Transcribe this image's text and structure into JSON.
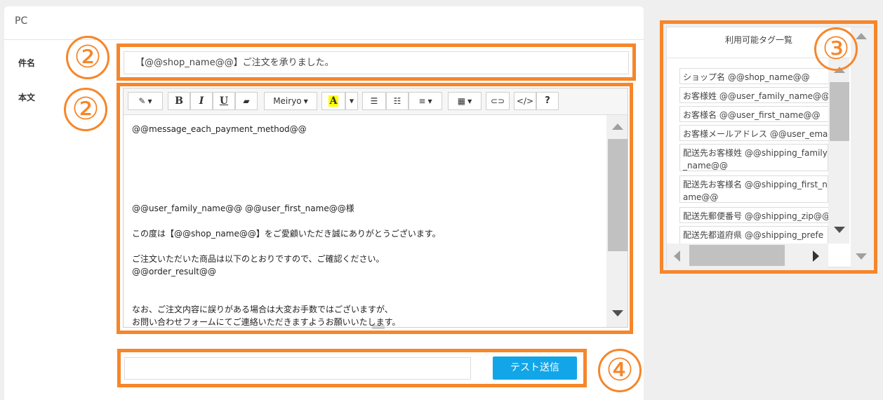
{
  "panel": {
    "title": "PC"
  },
  "subject": {
    "label": "件名",
    "value": "【@@shop_name@@】ご注文を承りました。"
  },
  "body": {
    "label": "本文",
    "lines": [
      "@@message_each_payment_method@@",
      "",
      "",
      "",
      "",
      "",
      "@@user_family_name@@ @@user_first_name@@様",
      "",
      "この度は【@@shop_name@@】をご愛顧いただき誠にありがとうございます。",
      "",
      "ご注文いただいた商品は以下のとおりですので、ご確認ください。",
      "@@order_result@@",
      "",
      "",
      "なお、ご注文内容に誤りがある場合は大変お手数ではございますが、",
      "お問い合わせフォームにてご連絡いただきますようお願いいたします。"
    ]
  },
  "toolbar": {
    "magic_label": "✎",
    "bold_label": "B",
    "italic_label": "I",
    "underline_label": "U",
    "eraser_label": "▰",
    "font_label": "Meiryo",
    "color_label": "A",
    "ul_label": "☰",
    "ol_label": "☷",
    "align_label": "≡",
    "table_label": "▦",
    "link_label": "⊂⊃",
    "code_label": "</>",
    "help_label": "?",
    "caret": "▼"
  },
  "callouts": [
    "②",
    "②",
    "③",
    "④"
  ],
  "test": {
    "button_label": "テスト送信",
    "value": ""
  },
  "tags": {
    "title": "利用可能タグ一覧",
    "items": [
      "ショップ名 @@shop_name@@",
      "お客様姓 @@user_family_name@@",
      "お客様名 @@user_first_name@@",
      "お客様メールアドレス @@user_email@@",
      "配送先お客様姓 @@shipping_family_name@@",
      "配送先お客様名 @@shipping_first_name@@",
      "配送先郵便番号 @@shipping_zip@@",
      "配送先都道府県 @@shipping_prefecture@@"
    ]
  },
  "colors": {
    "accent": "#f6862a",
    "button": "#12a6e8"
  }
}
